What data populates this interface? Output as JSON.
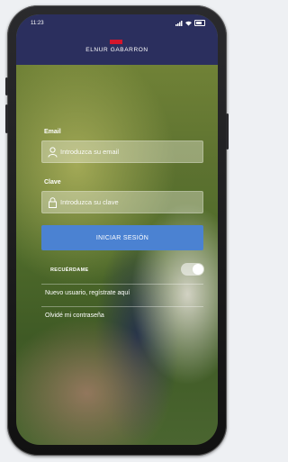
{
  "status": {
    "time": "11:23"
  },
  "header": {
    "brand": "ELNUR GABARRON"
  },
  "login": {
    "email_label": "Email",
    "email_placeholder": "Introduzca su email",
    "password_label": "Clave",
    "password_placeholder": "Introduzca su clave",
    "submit_label": "INICIAR SESIÓN",
    "remember_label": "RECUÉRDAME",
    "remember_on": true,
    "register_link": "Nuevo usuario, regístrate aquí",
    "forgot_link": "Olvidé mi contraseña"
  },
  "icons": {
    "status": [
      "signal-icon",
      "wifi-icon",
      "battery-icon"
    ],
    "email": "user-icon",
    "password": "lock-icon"
  },
  "colors": {
    "header_bg": "#2b2f5e",
    "brand_red": "#d3152b",
    "button_blue": "#4b82d2"
  }
}
